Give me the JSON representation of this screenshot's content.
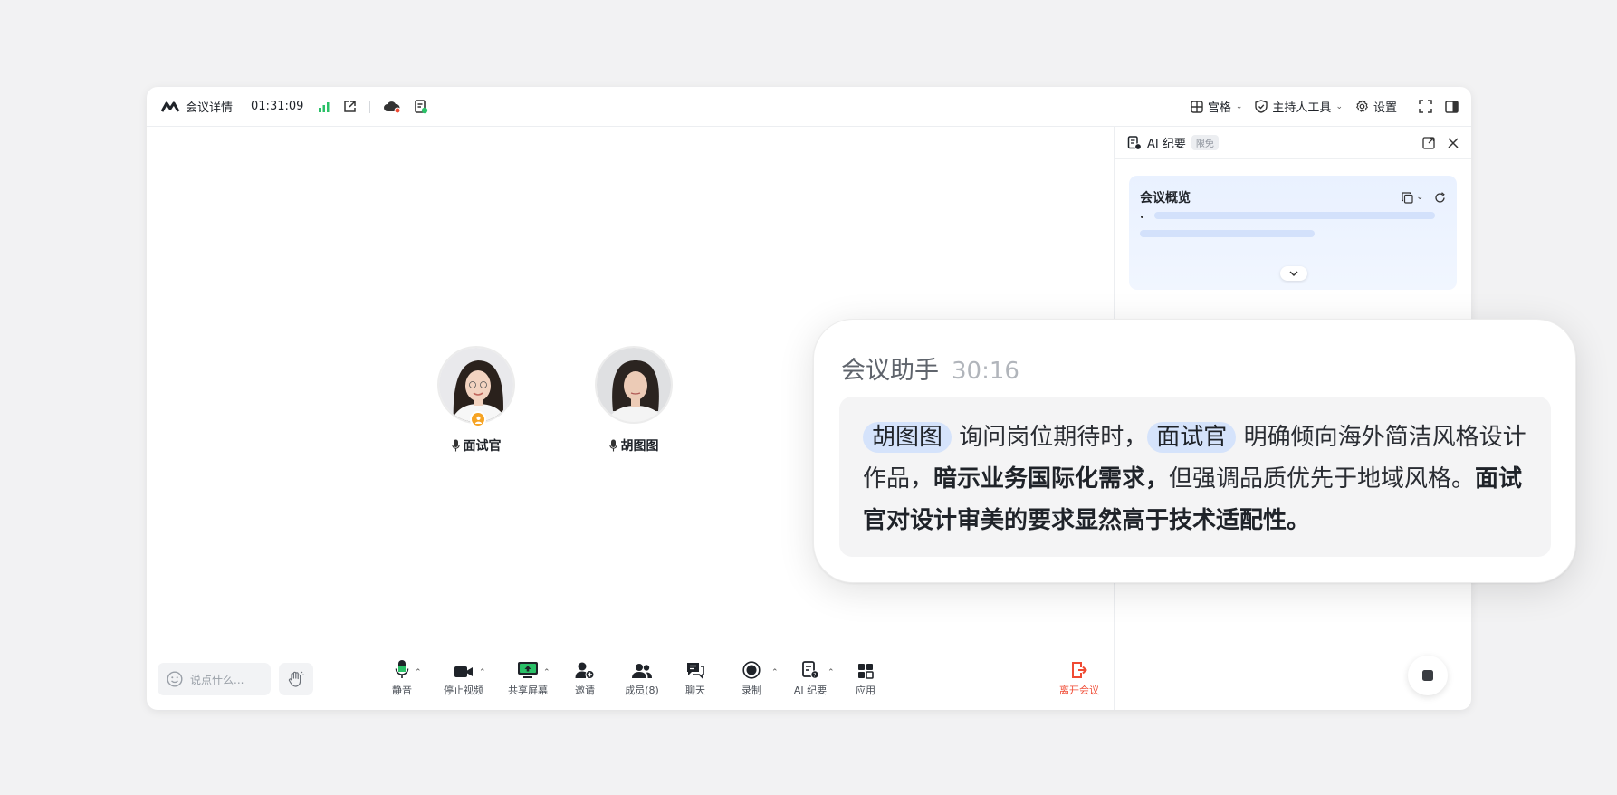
{
  "topbar": {
    "meeting_details": "会议详情",
    "elapsed": "01:31:09",
    "layout_label": "宫格",
    "host_tools_label": "主持人工具",
    "settings_label": "设置"
  },
  "participants": [
    {
      "name": "面试官",
      "is_host": true
    },
    {
      "name": "胡图图",
      "is_host": false
    }
  ],
  "bottombar": {
    "say_placeholder": "说点什么...",
    "tools": [
      {
        "label": "静音",
        "icon": "microphone-icon"
      },
      {
        "label": "停止视频",
        "icon": "video-camera-icon"
      },
      {
        "label": "共享屏幕",
        "icon": "share-screen-icon"
      },
      {
        "label": "邀请",
        "icon": "invite-user-icon"
      },
      {
        "label": "成员(8)",
        "icon": "members-icon"
      },
      {
        "label": "聊天",
        "icon": "chat-icon"
      },
      {
        "label": "录制",
        "icon": "record-icon"
      },
      {
        "label": "AI 纪要",
        "icon": "ai-notes-icon"
      },
      {
        "label": "应用",
        "icon": "apps-icon"
      }
    ],
    "leave_label": "离开会议"
  },
  "side_panel": {
    "title": "AI 纪要",
    "badge": "限免",
    "overview_title": "会议概览"
  },
  "assistant_card": {
    "title": "会议助手",
    "time": "30:16",
    "speaker_chip": "胡图图",
    "text_1": "询问岗位期待时，",
    "interviewer_chip": "面试官",
    "text_2": "明确倾向海外简洁风格设计作品，",
    "bold_1": "暗示业务国际化需求，",
    "text_3": "但强调品质优先于地域风格。",
    "bold_2": "面试官对设计审美的要求显然高于技术适配性。"
  },
  "colors": {
    "accent_blue": "#3370ff",
    "mic_green": "#2bc168",
    "leave_red": "#f04b34",
    "host_orange": "#f6a323"
  }
}
